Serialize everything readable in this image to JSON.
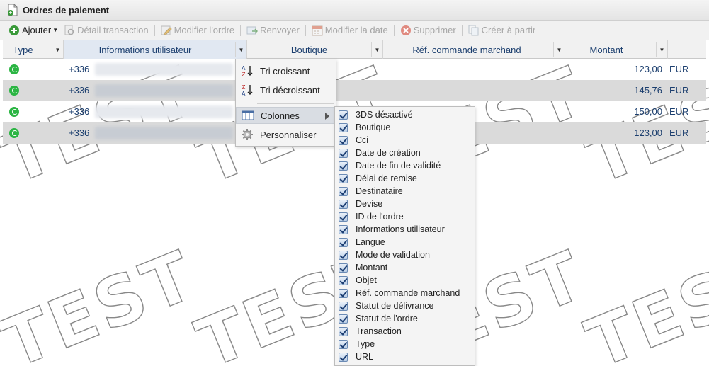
{
  "window": {
    "title": "Ordres de paiement"
  },
  "toolbar": {
    "add": "Ajouter",
    "detail": "Détail transaction",
    "edit": "Modifier l'ordre",
    "resend": "Renvoyer",
    "edit_date": "Modifier la date",
    "delete": "Supprimer",
    "create_from": "Créer à partir"
  },
  "columns": {
    "type": "Type",
    "info": "Informations utilisateur",
    "shop": "Boutique",
    "ref": "Réf. commande marchand",
    "amount": "Montant"
  },
  "rows": [
    {
      "phone": "+336",
      "amount": "123,00",
      "currency": "EUR",
      "icon": "whatsapp-icon"
    },
    {
      "phone": "+336",
      "amount": "145,76",
      "currency": "EUR",
      "icon": "whatsapp-icon"
    },
    {
      "phone": "+336",
      "amount": "150,00",
      "currency": "EUR",
      "icon": "whatsapp-icon"
    },
    {
      "phone": "+336",
      "amount": "123,00",
      "currency": "EUR",
      "icon": "whatsapp-icon"
    }
  ],
  "menu": {
    "sort_asc": "Tri croissant",
    "sort_desc": "Tri décroissant",
    "columns": "Colonnes",
    "customize": "Personnaliser"
  },
  "submenu": {
    "items": [
      {
        "label": "3DS désactivé",
        "checked": true
      },
      {
        "label": "Boutique",
        "checked": true
      },
      {
        "label": "Cci",
        "checked": true
      },
      {
        "label": "Date de création",
        "checked": true
      },
      {
        "label": "Date de fin de validité",
        "checked": true
      },
      {
        "label": "Délai de remise",
        "checked": true
      },
      {
        "label": "Destinataire",
        "checked": true
      },
      {
        "label": "Devise",
        "checked": true
      },
      {
        "label": "ID de l'ordre",
        "checked": true
      },
      {
        "label": "Informations utilisateur",
        "checked": true
      },
      {
        "label": "Langue",
        "checked": true
      },
      {
        "label": "Mode de validation",
        "checked": true
      },
      {
        "label": "Montant",
        "checked": true
      },
      {
        "label": "Objet",
        "checked": true
      },
      {
        "label": "Réf. commande marchand",
        "checked": true
      },
      {
        "label": "Statut de délivrance",
        "checked": true
      },
      {
        "label": "Statut de l'ordre",
        "checked": true
      },
      {
        "label": "Transaction",
        "checked": true
      },
      {
        "label": "Type",
        "checked": true
      },
      {
        "label": "URL",
        "checked": true
      }
    ]
  },
  "watermark": {
    "text": "TEST"
  },
  "colors": {
    "accent": "#1b3e6e",
    "whatsapp": "#2bb543",
    "row_alt": "#dadada"
  }
}
